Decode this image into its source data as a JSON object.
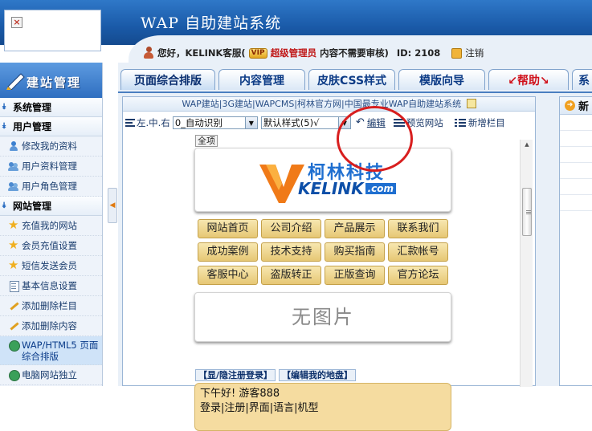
{
  "header": {
    "title": "WAP 自助建站系统"
  },
  "userbar": {
    "greeting": "您好，KELINK客服(",
    "vip_badge": "VIP",
    "role": "超级管理员",
    "closing": ")",
    "review_status": "内容不需要审核)",
    "id_text": "ID: 2108",
    "logout": "注销"
  },
  "sidebar": {
    "title": "建站管理",
    "sections": [
      {
        "label": "系统管理"
      },
      {
        "label": "用户管理",
        "items": [
          {
            "label": "修改我的资料",
            "icon": "person-icon"
          },
          {
            "label": "用户资料管理",
            "icon": "people-icon"
          },
          {
            "label": "用户角色管理",
            "icon": "people-icon"
          }
        ]
      },
      {
        "label": "网站管理",
        "items": [
          {
            "label": "充值我的网站",
            "icon": "star-icon"
          },
          {
            "label": "会员充值设置",
            "icon": "star-icon"
          },
          {
            "label": "短信发送会员",
            "icon": "star-icon"
          },
          {
            "label": "基本信息设置",
            "icon": "doc-icon"
          },
          {
            "label": "添加删除栏目",
            "icon": "pen-icon"
          },
          {
            "label": "添加删除内容",
            "icon": "pen-icon"
          },
          {
            "label": "WAP/HTML5 页面综合排版",
            "icon": "globe-icon"
          },
          {
            "label": "电脑网站独立",
            "icon": "globe-icon"
          }
        ]
      }
    ]
  },
  "tabs": [
    {
      "label": "页面综合排版",
      "active": true
    },
    {
      "label": "内容管理"
    },
    {
      "label": "皮肤CSS样式"
    },
    {
      "label": "模版向导"
    },
    {
      "label": "↙帮助↘"
    },
    {
      "label": "系"
    }
  ],
  "editor": {
    "title": "WAP建站|3G建站|WAPCMS|柯林官方网|中国最专业WAP自助建站系统",
    "toolbar": {
      "align_label": "左.中.右",
      "align_select": "0_自动识别",
      "style_select": "默认样式(5)√",
      "edit_link": "编辑",
      "preview_link": "预览网站",
      "add_column": "新增栏目"
    }
  },
  "preview": {
    "all_tag": "全项",
    "brand_cn": "柯林科技",
    "brand_en": "KELINK",
    "brand_com": ".com",
    "nav": [
      "网站首页",
      "公司介绍",
      "产品展示",
      "联系我们",
      "成功案例",
      "技术支持",
      "购买指南",
      "汇款帐号",
      "客服中心",
      "盗版转正",
      "正版查询",
      "官方论坛"
    ],
    "no_image": "无图片",
    "links": [
      "【显/隐注册登录】",
      "【编辑我的地盘】"
    ],
    "greeting_line": "下午好! 游客888",
    "greeting_links": "登录|注册|界面|语言|机型"
  },
  "right_panel": {
    "title": "新"
  },
  "colors": {
    "header_blue": "#1a5aa8",
    "accent_red": "#d81e1e",
    "nav_gold": "#e6c774",
    "link_blue": "#0c3b86"
  }
}
